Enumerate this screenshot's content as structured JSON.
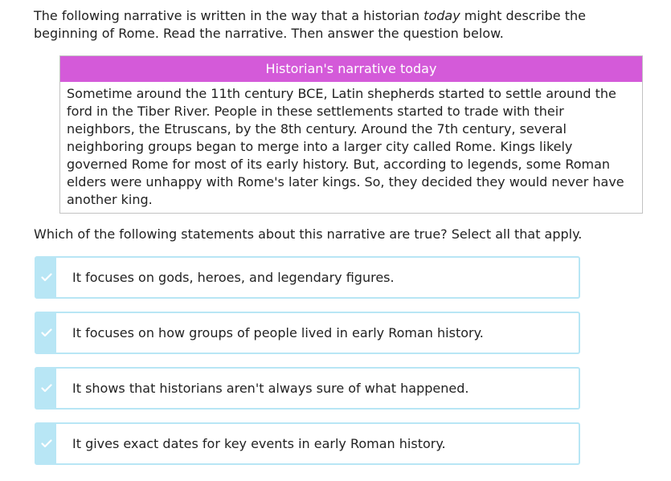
{
  "intro": {
    "before": "The following narrative is written in the way that a historian ",
    "emphasis": "today",
    "after": " might describe the beginning of Rome. Read the narrative. Then answer the question below."
  },
  "narrative": {
    "header": "Historian's narrative today",
    "body": "Sometime around the 11th century BCE, Latin shepherds started to settle around the ford in the Tiber River. People in these settlements started to trade with their neighbors, the Etruscans, by the 8th century. Around the 7th century, several neighboring groups began to merge into a larger city called Rome. Kings likely governed Rome for most of its early history. But, according to legends, some Roman elders were unhappy with Rome's later kings. So, they decided they would never have another king."
  },
  "question": "Which of the following statements about this narrative are true? Select all that apply.",
  "options": [
    {
      "label": "It focuses on gods, heroes, and legendary figures.",
      "icon": "checkmark-icon"
    },
    {
      "label": "It focuses on how groups of people lived in early Roman history.",
      "icon": "checkmark-icon"
    },
    {
      "label": "It shows that historians aren't always sure of what happened.",
      "icon": "checkmark-icon"
    },
    {
      "label": "It gives exact dates for key events in early Roman history.",
      "icon": "checkmark-icon"
    }
  ],
  "colors": {
    "header_bg": "#d45ad9",
    "option_border": "#b8e6f5",
    "text": "#222222"
  }
}
